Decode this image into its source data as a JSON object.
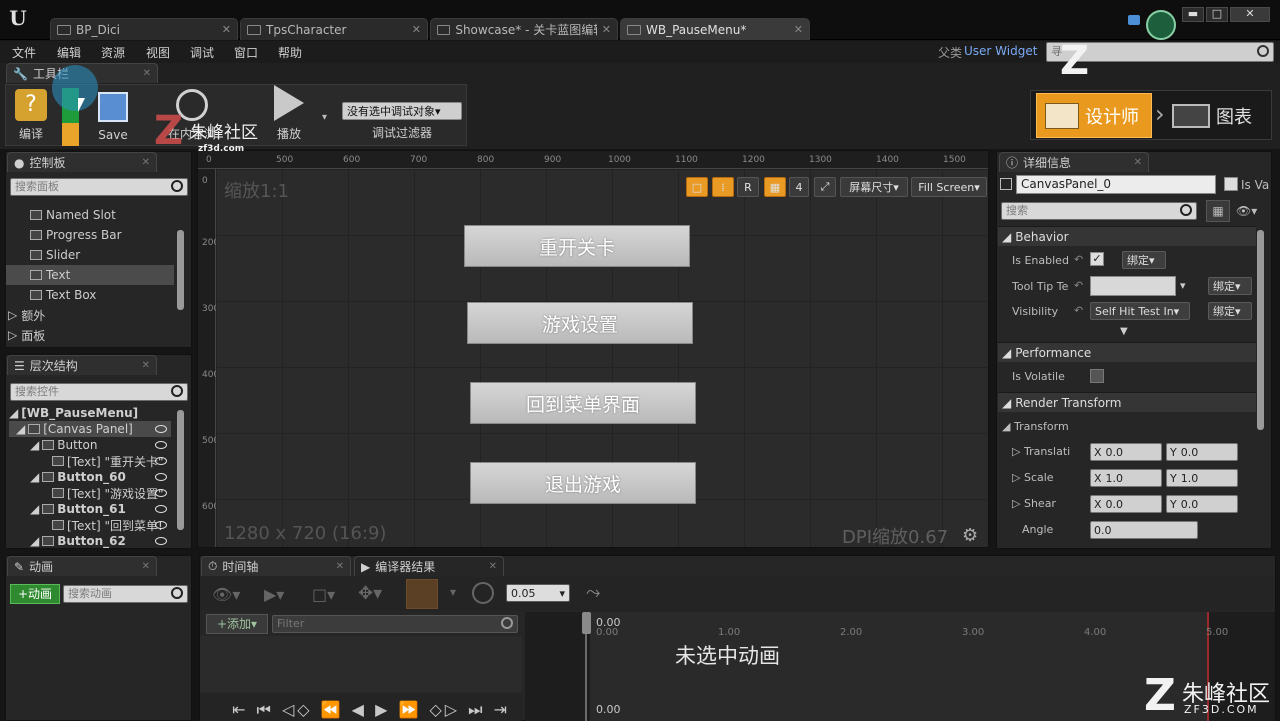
{
  "document_tabs": [
    "BP_Dici",
    "TpsCharacter",
    "Showcase* - 关卡蓝图编辑",
    "WB_PauseMenu*"
  ],
  "window_buttons": [
    "▬",
    "□",
    "✕"
  ],
  "menu": [
    "文件",
    "编辑",
    "资源",
    "视图",
    "调试",
    "窗口",
    "帮助"
  ],
  "parent_class": {
    "label": "父类",
    "value": "User Widget"
  },
  "top_search_placeholder": "寻",
  "toolbar": {
    "tab": "工具栏",
    "compile": "编译",
    "save": "Save",
    "browse": "在内容浏",
    "play": "播放",
    "debug_object": "没有选中调试对象▾",
    "debug_filter": "调试过滤器"
  },
  "mode_switch": {
    "designer": "设计师",
    "graph": "图表"
  },
  "palette": {
    "tab": "控制板",
    "search_placeholder": "搜索面板",
    "items": [
      "Named Slot",
      "Progress Bar",
      "Slider",
      "Text",
      "Text Box"
    ],
    "categories": [
      "额外",
      "面板"
    ]
  },
  "hierarchy": {
    "tab": "层次结构",
    "search_placeholder": "搜索控件",
    "rows": [
      "[WB_PauseMenu]",
      "[Canvas Panel]",
      "Button",
      "[Text] \"重开关卡\"",
      "Button_60",
      "[Text] \"游戏设置\"",
      "Button_61",
      "[Text] \"回到菜单!",
      "Button_62"
    ]
  },
  "designer": {
    "zoom": "缩放1:1",
    "resolution": "1280 x 720 (16:9)",
    "dpi": "DPI缩放0.67",
    "ruler_top": [
      "0",
      "500",
      "600",
      "700",
      "800",
      "900",
      "1000",
      "1100",
      "1200",
      "1300",
      "1400",
      "1500"
    ],
    "ruler_left": [
      "0",
      "200",
      "300",
      "400",
      "500",
      "600"
    ],
    "tools": [
      "R",
      "4",
      "屏幕尺寸▾",
      "Fill Screen▾"
    ],
    "buttons": [
      "重开关卡",
      "游戏设置",
      "回到菜单界面",
      "退出游戏"
    ]
  },
  "details": {
    "tab": "详细信息",
    "widget_name": "CanvasPanel_0",
    "is_variable": "Is Va",
    "search_placeholder": "搜索",
    "sections": {
      "behavior": "Behavior",
      "performance": "Performance",
      "render_transform": "Render Transform"
    },
    "props": {
      "is_enabled": "Is Enabled",
      "tooltip": "Tool Tip Te",
      "visibility": "Visibility",
      "visibility_value": "Self Hit Test In▾",
      "bind": "绑定▾",
      "is_volatile": "Is Volatile",
      "transform": "Transform",
      "translation": "Translati",
      "scale": "Scale",
      "shear": "Shear",
      "angle": "Angle",
      "translation_x": "0.0",
      "translation_y": "0.0",
      "scale_x": "1.0",
      "scale_y": "1.0",
      "shear_x": "0.0",
      "shear_y": "0.0",
      "angle_value": "0.0",
      "x_label": "X",
      "y_label": "Y"
    }
  },
  "animations": {
    "tab": "动画",
    "add": "+动画",
    "search_placeholder": "搜索动画"
  },
  "timeline": {
    "tab": "时间轴",
    "compiler_tab": "编译器结果",
    "time_value": "0.05",
    "add": "+添加▾",
    "filter_placeholder": "Filter",
    "no_animation": "未选中动画",
    "ticks": [
      "0.00",
      "1.00",
      "2.00",
      "3.00",
      "4.00",
      "5.00"
    ],
    "bottom_value": "0.00"
  },
  "watermark": {
    "brand": "朱峰社区",
    "url": "ZF3D.COM",
    "overlay": "朱峰社区",
    "overlay_url": "zf3d.com"
  }
}
